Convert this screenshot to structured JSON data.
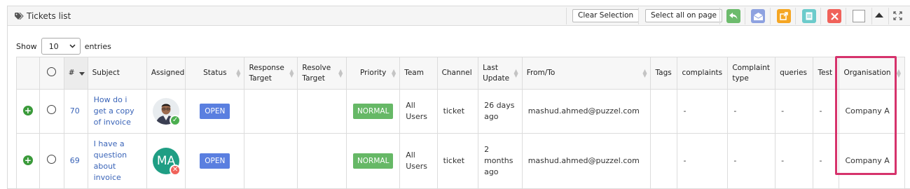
{
  "header": {
    "title": "Tickets list",
    "title_icon": "tag-icon",
    "clear_selection_label": "Clear Selection",
    "select_all_label": "Select all on page",
    "toolbar_icons": [
      {
        "name": "reply-icon",
        "color": "#6dbb6d"
      },
      {
        "name": "envelope-open-icon",
        "color": "#8ea2e0"
      },
      {
        "name": "export-icon",
        "color": "#f5a623"
      },
      {
        "name": "document-icon",
        "color": "#6ccbcb"
      },
      {
        "name": "close-icon",
        "color": "#f0625a"
      }
    ]
  },
  "length_control": {
    "show_label": "Show",
    "value": "10",
    "entries_label": "entries"
  },
  "table": {
    "columns": {
      "number": "#",
      "subject": "Subject",
      "assigned": "Assigned",
      "status": "Status",
      "response_target": "Response Target",
      "resolve_target": "Resolve Target",
      "priority": "Priority",
      "team": "Team",
      "channel": "Channel",
      "last_update": "Last Update",
      "from_to": "From/To",
      "tags": "Tags",
      "complaints": "complaints",
      "complaint_type": "Complaint type",
      "queries": "queries",
      "test": "Test",
      "organisation": "Organisation"
    },
    "rows": [
      {
        "number": "70",
        "subject": "How do i get a copy of invoice",
        "assigned_type": "photo",
        "assigned_status": "online",
        "status": "OPEN",
        "response_target": "",
        "resolve_target": "",
        "priority": "NORMAL",
        "team": "All Users",
        "channel": "ticket",
        "last_update": "26 days ago",
        "from_to": "mashud.ahmed@puzzel.com",
        "tags": "",
        "complaints": "-",
        "complaint_type": "-",
        "queries": "-",
        "test": "-",
        "organisation": "Company A"
      },
      {
        "number": "69",
        "subject": "I have a question about invoice",
        "assigned_type": "initials",
        "assigned_initials": "MA",
        "assigned_status": "offline",
        "status": "OPEN",
        "response_target": "",
        "resolve_target": "",
        "priority": "NORMAL",
        "team": "All Users",
        "channel": "ticket",
        "last_update": "2 months ago",
        "from_to": "mashud.ahmed@puzzel.com",
        "tags": "",
        "complaints": "-",
        "complaint_type": "-",
        "queries": "-",
        "test": "-",
        "organisation": "Company A"
      }
    ]
  },
  "colors": {
    "open_badge": "#5a7fe0",
    "normal_badge": "#66b866",
    "link": "#3a64b8",
    "highlight": "#d6336c"
  }
}
